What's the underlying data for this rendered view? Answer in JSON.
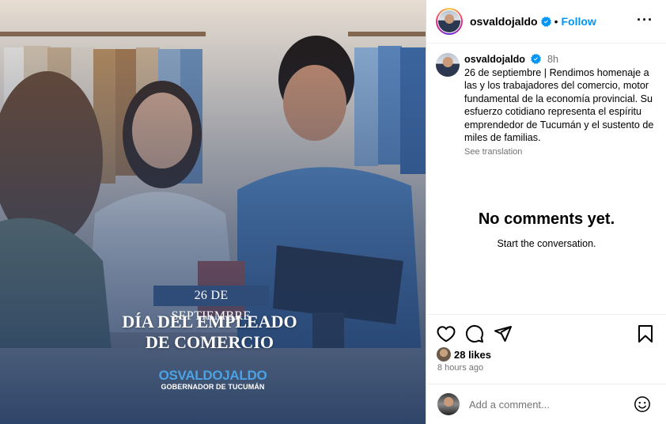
{
  "post_image": {
    "date_banner": "26 DE SEPTIEMBRE",
    "title_line1": "DÍA DEL EMPLEADO",
    "title_line2": "DE COMERCIO",
    "brand_part1": "OSVALDO",
    "brand_part2": "JALDO",
    "brand_subtitle": "GOBERNADOR DE TUCUMÁN"
  },
  "header": {
    "username": "osvaldojaldo",
    "separator": "•",
    "follow_label": "Follow",
    "more_label": "···",
    "verified_icon": "verified-badge-icon"
  },
  "caption": {
    "username": "osvaldojaldo",
    "time": "8h",
    "text": "26 de septiembre | Rendimos homenaje a las y los trabajadores del comercio, motor fundamental de la economía provincial. Su esfuerzo cotidiano representa el espíritu emprendedor de Tucumán y el sustento de miles de familias.",
    "see_translation": "See translation"
  },
  "comments": {
    "empty_title": "No comments yet.",
    "empty_subtitle": "Start the conversation."
  },
  "actions": {
    "icons": [
      "heart-icon",
      "comment-icon",
      "share-icon",
      "bookmark-icon"
    ]
  },
  "stats": {
    "likes": "28 likes",
    "posted_ago": "8 hours ago"
  },
  "comment_input": {
    "placeholder": "Add a comment...",
    "emoji_icon": "emoji-icon"
  },
  "colors": {
    "accent": "#0095f6",
    "verified": "#0095f6",
    "banner": "#2f4b78",
    "muted": "#737373"
  }
}
